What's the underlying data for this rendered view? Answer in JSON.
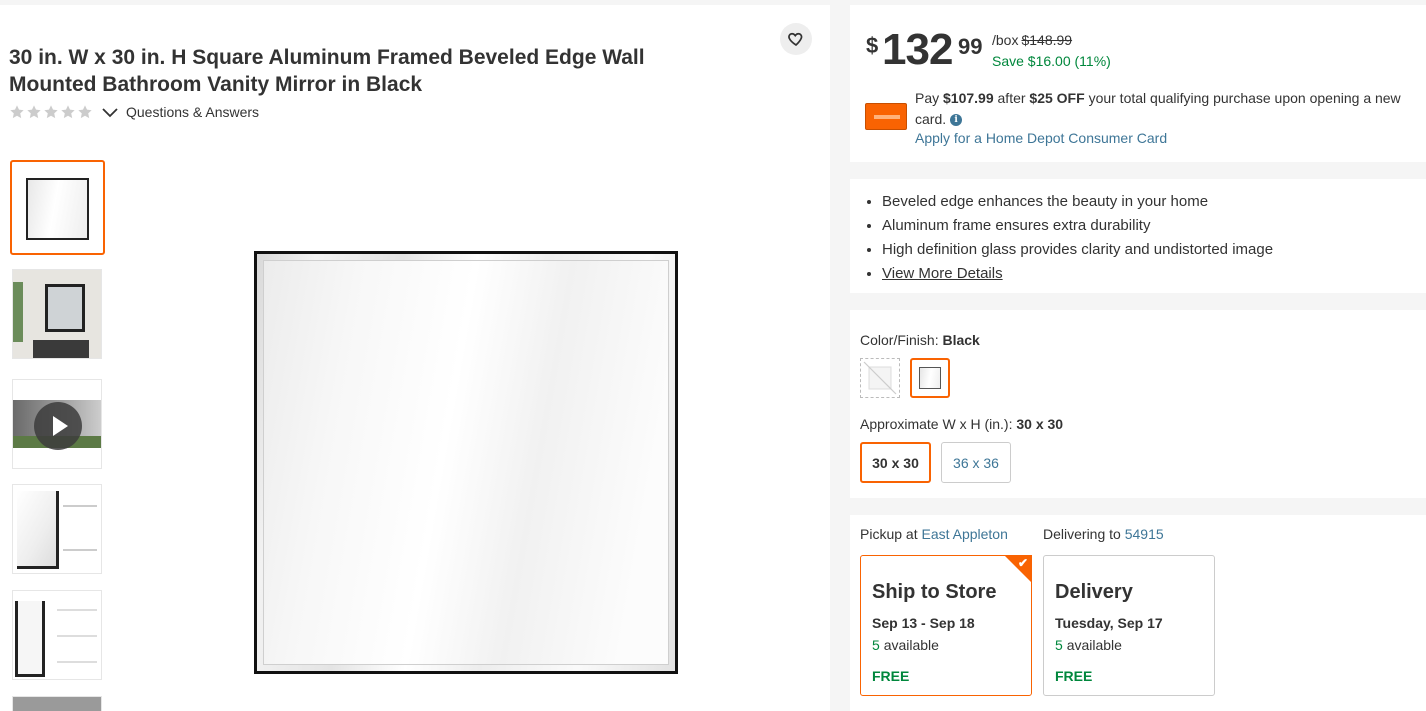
{
  "product": {
    "title": "30 in. W x 30 in. H Square Aluminum Framed Beveled Edge Wall Mounted Bathroom Vanity Mirror in Black",
    "questions_link": "Questions & Answers",
    "rating_stars": 0,
    "icons": {
      "favorite": "heart-icon",
      "expand": "chevron-down-icon",
      "play": "play-icon"
    }
  },
  "gallery": {
    "thumbnails": [
      {
        "kind": "front view",
        "selected": true
      },
      {
        "kind": "bathroom scene",
        "selected": false
      },
      {
        "kind": "video",
        "selected": false
      },
      {
        "kind": "beveled edge detail",
        "selected": false
      },
      {
        "kind": "dimensions",
        "selected": false
      },
      {
        "kind": "more",
        "selected": false
      }
    ]
  },
  "price": {
    "currency": "$",
    "dollars": "132",
    "cents": "99",
    "unit": "/box",
    "original": "$148.99",
    "savings": "Save $16.00 (11%)"
  },
  "card_offer": {
    "pay": "Pay",
    "pay_amount": "$107.99",
    "after": "after",
    "discount": "$25 OFF",
    "rest": "your total qualifying purchase upon opening a new card.",
    "apply_link": "Apply for a Home Depot Consumer Card"
  },
  "highlights": {
    "items": [
      "Beveled edge enhances the beauty in your home",
      "Aluminum frame ensures extra durability",
      "High definition glass provides clarity and undistorted image"
    ],
    "more_link": "View More Details"
  },
  "options": {
    "color_label": "Color/Finish:",
    "color_value": "Black",
    "size_label": "Approximate W x H (in.):",
    "size_value": "30 x 30",
    "sizes": [
      "30 x 30",
      "36 x 36"
    ]
  },
  "fulfillment": {
    "pickup_label": "Pickup at",
    "pickup_store": "East Appleton",
    "deliver_label": "Delivering to",
    "zip": "54915",
    "ship": {
      "title": "Ship to Store",
      "dates": "Sep 13 - Sep 18",
      "count": "5",
      "avail_text": "available",
      "price": "FREE"
    },
    "delivery": {
      "title": "Delivery",
      "dates": "Tuesday, Sep 17",
      "count": "5",
      "avail_text": "available",
      "price": "FREE"
    }
  },
  "colors": {
    "accent": "#f96302",
    "link": "#3e7697",
    "success": "#00873c"
  }
}
